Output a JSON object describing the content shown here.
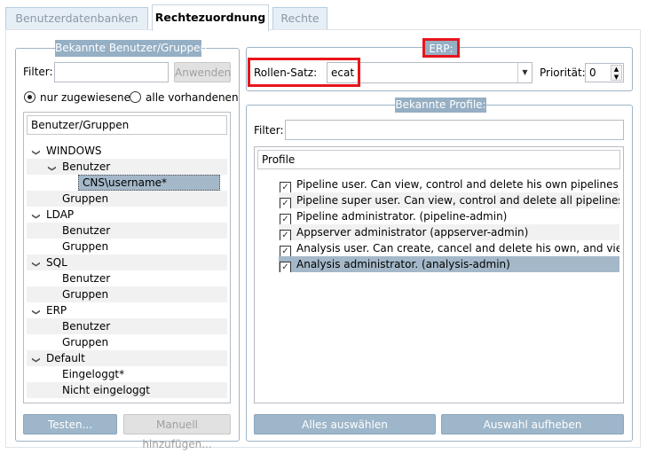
{
  "tabs": [
    {
      "label": "Benutzerdatenbanken"
    },
    {
      "label": "Rechtezuordnung"
    },
    {
      "label": "Rechte"
    }
  ],
  "left": {
    "title": "Bekannte Benutzer/Gruppen:",
    "filter_label": "Filter:",
    "filter_value": "",
    "apply": "Anwenden",
    "radio_assigned": "nur zugewiesene",
    "radio_all": "alle vorhandenen",
    "tree_header": "Benutzer/Gruppen",
    "tree": [
      {
        "label": "WINDOWS",
        "level": 0,
        "expanded": true
      },
      {
        "label": "Benutzer",
        "level": 1,
        "expanded": true
      },
      {
        "label": "CNS\\username*",
        "level": 2,
        "selected": true
      },
      {
        "label": "Gruppen",
        "level": 1
      },
      {
        "label": "LDAP",
        "level": 0,
        "expanded": true
      },
      {
        "label": "Benutzer",
        "level": 1
      },
      {
        "label": "Gruppen",
        "level": 1
      },
      {
        "label": "SQL",
        "level": 0,
        "expanded": true
      },
      {
        "label": "Benutzer",
        "level": 1
      },
      {
        "label": "Gruppen",
        "level": 1
      },
      {
        "label": "ERP",
        "level": 0,
        "expanded": true
      },
      {
        "label": "Benutzer",
        "level": 1
      },
      {
        "label": "Gruppen",
        "level": 1
      },
      {
        "label": "Default",
        "level": 0,
        "expanded": true
      },
      {
        "label": "Eingeloggt*",
        "level": 1
      },
      {
        "label": "Nicht eingeloggt",
        "level": 1
      }
    ],
    "test": "Testen...",
    "manual": "Manuell hinzufügen..."
  },
  "erp": {
    "title": "ERP:",
    "role_label": "Rollen-Satz:",
    "role_value": "ecat",
    "prio_label": "Priorität:",
    "prio_value": "0"
  },
  "profiles": {
    "title": "Bekannte Profile:",
    "filter_label": "Filter:",
    "filter_value": "",
    "header": "Profile",
    "items": [
      {
        "label": "Pipeline user. Can view, control and delete his own pipelines. (pipel...",
        "checked": true
      },
      {
        "label": "Pipeline super user. Can view, control and delete all pipelines. (pipe...",
        "checked": true
      },
      {
        "label": "Pipeline administrator. (pipeline-admin)",
        "checked": true
      },
      {
        "label": "Appserver administrator (appserver-admin)",
        "checked": true
      },
      {
        "label": "Analysis user. Can create, cancel and delete his own, and view all a...",
        "checked": true
      },
      {
        "label": "Analysis administrator. (analysis-admin)",
        "checked": true,
        "selected": true
      }
    ],
    "select_all": "Alles auswählen",
    "deselect": "Auswahl aufheben"
  },
  "colors": {
    "highlight": "#e8151b",
    "selection": "#a4b8c9",
    "group_title": "#95afc4"
  }
}
